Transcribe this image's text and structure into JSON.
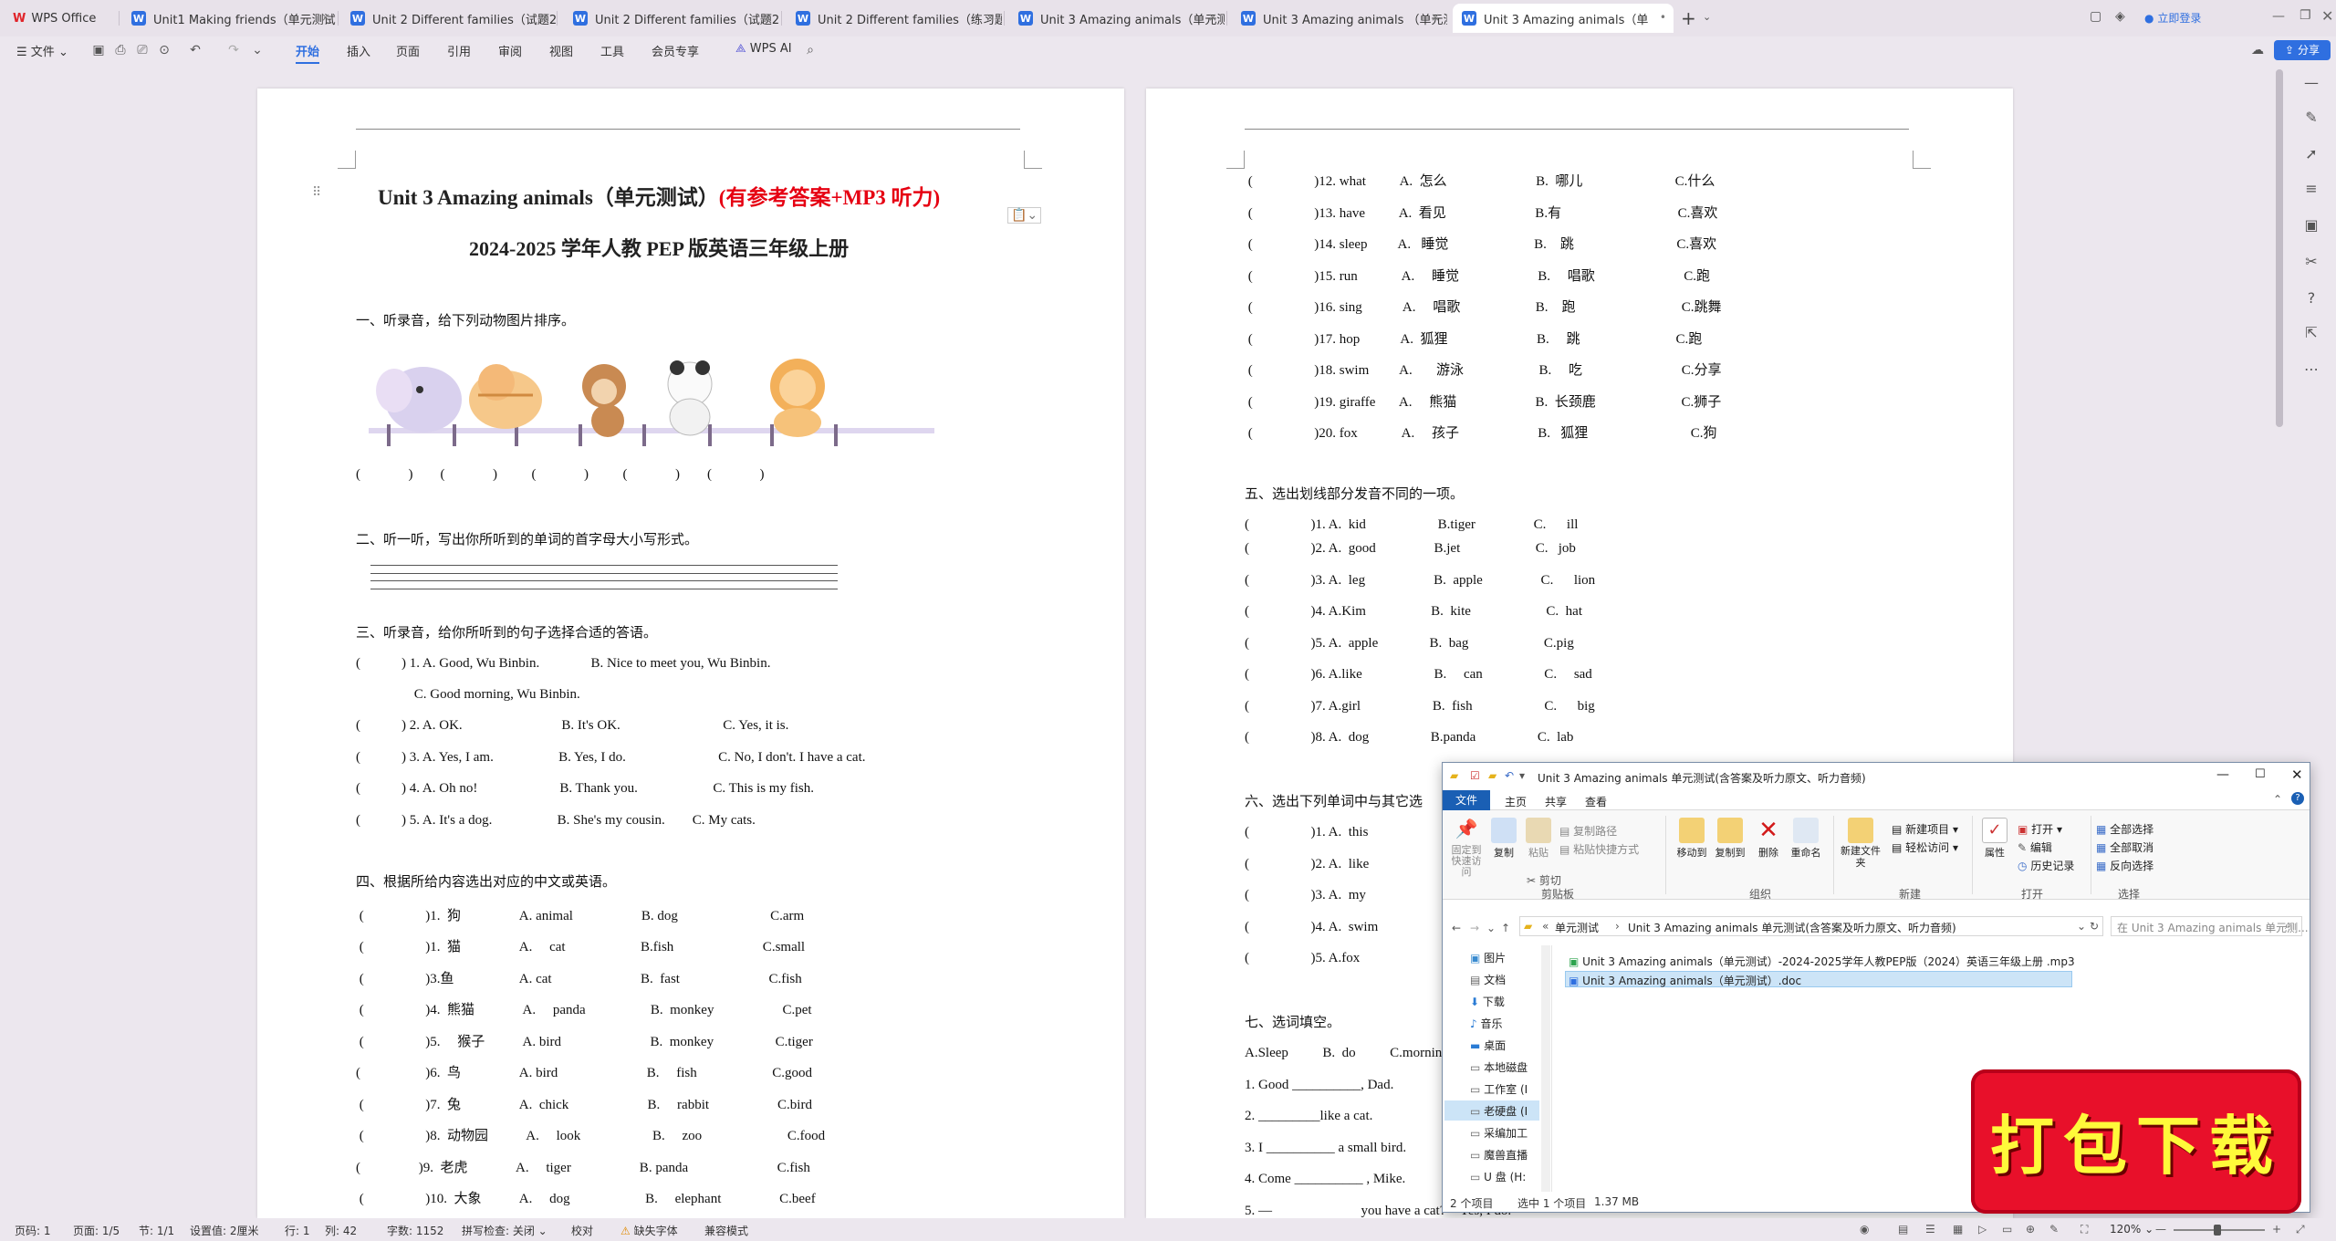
{
  "tabs": [
    {
      "label": "WPS Office"
    },
    {
      "label": "Unit1 Making friends（单元测试"
    },
    {
      "label": "Unit 2 Different families（试题2"
    },
    {
      "label": "Unit 2 Different families（试题2"
    },
    {
      "label": "Unit 2 Different families（练习题"
    },
    {
      "label": "Unit 3 Amazing animals（单元测"
    },
    {
      "label": "Unit 3 Amazing animals （单元测"
    },
    {
      "label": "Unit 3 Amazing animals（单"
    }
  ],
  "titlebar": {
    "login": "立即登录",
    "share": "分享"
  },
  "menu": {
    "file": "文件",
    "items": [
      "开始",
      "插入",
      "页面",
      "引用",
      "审阅",
      "视图",
      "工具",
      "会员专享"
    ],
    "ai": "WPS AI"
  },
  "doc_left": {
    "title_black": "Unit 3 Amazing animals（单元测试）",
    "title_red": "(有参考答案+MP3 听力)",
    "subtitle": "2024-2025 学年人教 PEP 版英语三年级上册",
    "s1": "一、听录音，给下列动物图片排序。",
    "s1_blanks": "(              )        (              )          (              )          (              )        (              )",
    "s2": "二、听一听，写出你所听到的单词的首字母大小写形式。",
    "s3": "三、听录音，给你所听到的句子选择合适的答语。",
    "s3_lines": [
      "(            ) 1. A. Good, Wu Binbin.               B. Nice to meet you, Wu Binbin.",
      "                 C. Good morning, Wu Binbin.",
      "(            ) 2. A. OK.                             B. It's OK.                              C. Yes, it is.",
      "(            ) 3. A. Yes, I am.                   B. Yes, I do.                           C. No, I don't. I have a cat.",
      "(            ) 4. A. Oh no!                        B. Thank you.                      C. This is my fish.",
      "(            ) 5. A. It's a dog.                   B. She's my cousin.        C. My cats."
    ],
    "s4": "四、根据所给内容选出对应的中文或英语。",
    "s4_lines": [
      " (                  )1.  狗                 A. animal                    B. dog                           C.arm",
      " (                  )1.  猫                 A.     cat                      B.fish                          C.small",
      " (                  )3.鱼                   A. cat                          B.  fast                          C.fish",
      " (                  )4.  熊猫              A.     panda                   B.  monkey                    C.pet",
      " (                  )5.     猴子           A. bird                          B.  monkey                  C.tiger",
      "(                   )6.  鸟                 A. bird                          B.     fish                      C.good",
      " (                  )7.  兔                 A.  chick                       B.     rabbit                    C.bird",
      " (                  )8.  动物园           A.     look                     B.     zoo                         C.food",
      "(                 )9.  老虎              A.     tiger                    B. panda                          C.fish",
      " (                  )10.  大象           A.     dog                      B.     elephant                 C.beef"
    ]
  },
  "doc_right": {
    "s4_cont": [
      " (                  )12. what          A.  怎么                          B.  哪儿                           C.什么",
      " (                  )13. have          A.  看见                          B.有                                  C.喜欢",
      " (                  )14. sleep         A.   睡觉                         B.    跳                              C.喜欢",
      " (                  )15. run             A.     睡觉                       B.     唱歌                          C.跑",
      " (                  )16. sing            A.     唱歌                      B.    跑                               C.跳舞",
      " (                  )17. hop            A.  狐狸                          B.     跳                            C.跑",
      " (                  )18. swim         A.       游泳                      B.     吃                             C.分享",
      " (                  )19. giraffe       A.     熊猫                       B.  长颈鹿                         C.狮子",
      " (                  )20. fox             A.     孩子                       B.   狐狸                              C.狗"
    ],
    "s5": "五、选出划线部分发音不同的一项。",
    "s5_lines": [
      "(                  )1. A.  kid                     B.tiger                 C.      ill",
      "(                  )2. A.  good                 B.jet                      C.   job",
      "(                  )3. A.  leg                    B.  apple                 C.      lion",
      "(                  )4. A.Kim                   B.  kite                      C.  hat",
      "(                  )5. A.  apple               B.  bag                      C.pig",
      "(                  )6. A.like                     B.     can                  C.     sad",
      "(                  )7. A.girl                     B.  fish                     C.      big",
      "(                  )8. A.  dog                  B.panda                  C.  lab"
    ],
    "s6": "六、选出下列单词中与其它选",
    "s6_lines": [
      "(                  )1. A.  this",
      "(                  )2. A.  like",
      "(                  )3. A.  my",
      "(                  )4. A.  swim",
      "(                  )5. A.fox"
    ],
    "s7": "七、选词填空。",
    "s7_lines": [
      "A.Sleep          B.  do          C.mornin",
      "1. Good __________, Dad.",
      "2. _________like a cat.",
      "3. I __________ a small bird.",
      "4. Come __________ , Mike.",
      "5. —                          you have a cat?—Yes, I do."
    ]
  },
  "explorer": {
    "title": "Unit 3 Amazing animals 单元测试(含答案及听力原文、听力音频)",
    "ribbon_tabs": [
      "文件",
      "主页",
      "共享",
      "查看"
    ],
    "groups": {
      "clipboard": {
        "label": "剪贴板",
        "pin": "固定到快速访问",
        "copy": "复制",
        "paste": "粘贴",
        "copy_path": "复制路径",
        "paste_shortcut": "粘贴快捷方式",
        "cut": "剪切"
      },
      "organize": {
        "label": "组织",
        "move": "移动到",
        "copyto": "复制到",
        "delete": "删除",
        "rename": "重命名"
      },
      "new": {
        "label": "新建",
        "new_folder": "新建文件夹",
        "new_item": "新建项目",
        "easy_access": "轻松访问"
      },
      "open": {
        "label": "打开",
        "properties": "属性",
        "open": "打开",
        "edit": "编辑",
        "history": "历史记录"
      },
      "select": {
        "label": "选择",
        "select_all": "全部选择",
        "select_none": "全部取消",
        "invert": "反向选择"
      }
    },
    "breadcrumb": [
      "单元测试",
      "Unit 3 Amazing animals 单元测试(含答案及听力原文、听力音频)"
    ],
    "search_placeholder": "在 Unit 3 Amazing animals 单元测...",
    "nav": [
      "图片",
      "文档",
      "下载",
      "音乐",
      "桌面",
      "本地磁盘",
      "工作室 (I",
      "老硬盘 (I",
      "采编加工",
      "魔兽直播",
      "U 盘 (H:"
    ],
    "files": [
      "Unit 3 Amazing animals（单元测试）-2024-2025学年人教PEP版（2024）英语三年级上册 .mp3",
      "Unit 3 Amazing animals（单元测试）.doc"
    ],
    "status": {
      "count": "2 个项目",
      "selected": "选中 1 个项目",
      "size": "1.37 MB"
    }
  },
  "badge": {
    "text": "打包下载"
  },
  "statusbar": {
    "page_no": "页码: 1",
    "pages": "页面: 1/5",
    "section": "节: 1/1",
    "setting": "设置值: 2厘米",
    "row": "行: 1",
    "col": "列: 42",
    "words": "字数: 1152",
    "spell": "拼写检查: 关闭",
    "proof": "校对",
    "missing_font": "缺失字体",
    "compat": "兼容模式",
    "zoom": "120%"
  },
  "colors": {
    "accent": "#2f6fe0",
    "title_red": "#e60012",
    "badge_red": "#e8102a"
  }
}
